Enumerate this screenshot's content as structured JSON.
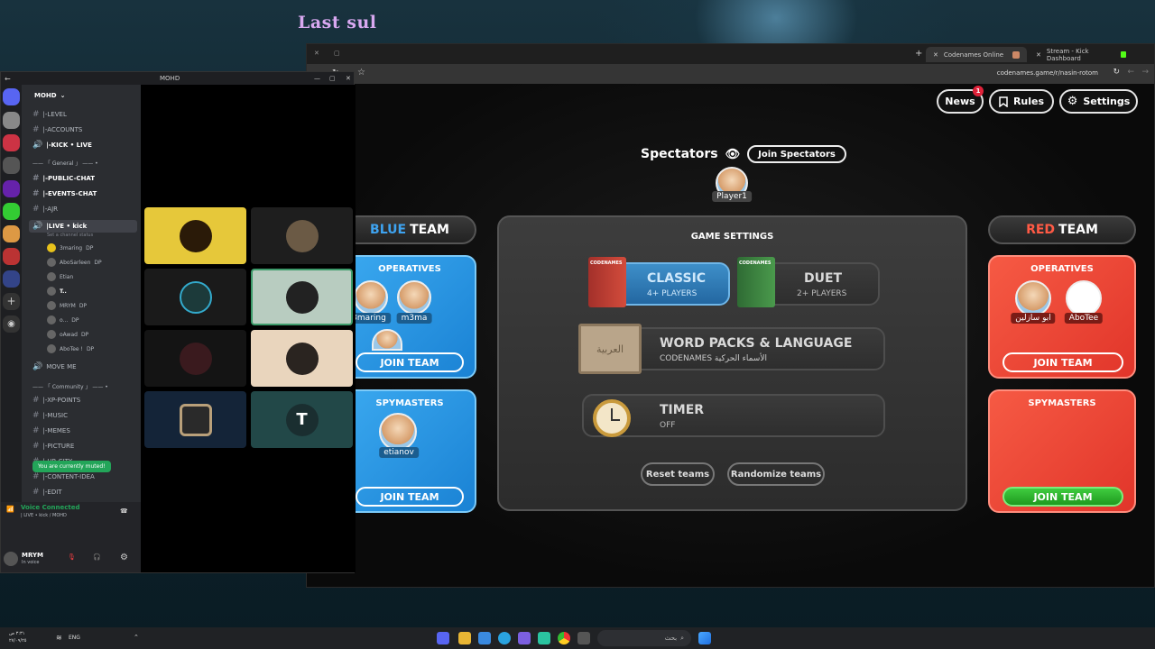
{
  "wallpaper": {
    "title": "Last sul"
  },
  "browser": {
    "tabs": [
      {
        "label": "Codenames Online",
        "active": true
      },
      {
        "label": "Stream - Kick Dashboard",
        "active": false
      }
    ],
    "url": "codenames.game/r/nasin-rotom",
    "new_tab_icon": "+"
  },
  "game": {
    "top_buttons": {
      "news": "News",
      "news_badge": "1",
      "rules": "Rules",
      "settings": "Settings"
    },
    "spectators": {
      "label": "Spectators",
      "join_label": "Join Spectators",
      "player": "Player1"
    },
    "blue_team": {
      "title_color_word": "BLUE",
      "title_rest": "TEAM",
      "operatives_title": "OPERATIVES",
      "operatives": [
        "3maring",
        "m3ma"
      ],
      "join_label": "JOIN TEAM",
      "spymasters_title": "SPYMASTERS",
      "spymasters": [
        "etianov"
      ],
      "spymaster_join_label": "JOIN TEAM"
    },
    "red_team": {
      "title_color_word": "RED",
      "title_rest": "TEAM",
      "operatives_title": "OPERATIVES",
      "operatives": [
        "ابو سازلين",
        "AboTee"
      ],
      "join_label": "JOIN TEAM",
      "spymasters_title": "SPYMASTERS",
      "spymaster_join_label": "JOIN TEAM"
    },
    "settings_panel": {
      "title": "GAME SETTINGS",
      "classic": {
        "label": "CLASSIC",
        "players": "4+ PLAYERS",
        "box_text": "CODENAMES"
      },
      "duet": {
        "label": "DUET",
        "players": "2+ PLAYERS",
        "box_text": "CODENAMES"
      },
      "word_packs": {
        "label": "WORD PACKS & LANGUAGE",
        "value": "CODENAMES الأسماء الحركية",
        "box_text": "العربية"
      },
      "timer": {
        "label": "TIMER",
        "value": "OFF"
      },
      "reset": "Reset teams",
      "randomize": "Randomize teams"
    },
    "colors": {
      "blue": "#2a93e6",
      "red": "#ef4836",
      "green": "#2db52d"
    }
  },
  "discord": {
    "window_title": "MOHD",
    "server_name": "MOHD",
    "channels": [
      {
        "name": "|-LEVEL",
        "type": "text",
        "bold": false
      },
      {
        "name": "|-ACCOUNTS",
        "type": "text",
        "bold": false
      },
      {
        "name": "|-KICK • LIVE",
        "type": "voice",
        "bold": true
      },
      {
        "name": "—— 「 General 」 —— •",
        "type": "category",
        "bold": false
      },
      {
        "name": "|-PUBLIC-CHAT",
        "type": "text",
        "bold": true
      },
      {
        "name": "|-EVENTS-CHAT",
        "type": "text",
        "bold": true
      },
      {
        "name": "|-AJR",
        "type": "text",
        "bold": false
      },
      {
        "name": "|LIVE • kick",
        "type": "voice",
        "bold": true
      }
    ],
    "live_status": "Set a channel status",
    "voice_users": [
      {
        "name": "3maring",
        "badge": "DP"
      },
      {
        "name": "AboSarleen",
        "badge": "DP"
      },
      {
        "name": "Etian",
        "badge": ""
      },
      {
        "name": "T..",
        "badge": ""
      },
      {
        "name": "MRYM",
        "badge": "DP"
      },
      {
        "name": "o...",
        "badge": "DP"
      },
      {
        "name": "oAwad",
        "badge": "DP"
      },
      {
        "name": "AboTee !",
        "badge": "DP"
      }
    ],
    "channels2": [
      {
        "name": "MOVE ME",
        "type": "voice"
      },
      {
        "name": "—— 「 Community 」 —— •",
        "type": "category"
      },
      {
        "name": "|-XP-POINTS",
        "type": "text"
      },
      {
        "name": "|-MUSIC",
        "type": "text"
      },
      {
        "name": "|-MEMES",
        "type": "text"
      },
      {
        "name": "|-PICTURE",
        "type": "text"
      },
      {
        "name": "|-UR-CITY",
        "type": "text"
      },
      {
        "name": "|-CONTENT-IDEA",
        "type": "text"
      },
      {
        "name": "|-EDIT",
        "type": "text"
      }
    ],
    "voice_connected": "Voice Connected",
    "voice_channel": "| LIVE • kick / MOHD",
    "muted_tip": "You are currently muted!",
    "user": {
      "name": "MRYM",
      "status": "In voice"
    }
  },
  "taskbar": {
    "lang": "ENG",
    "search_placeholder": "بحث",
    "time": "٣:٣١ ص",
    "date": "٢٧/٠٩/٢٥"
  }
}
